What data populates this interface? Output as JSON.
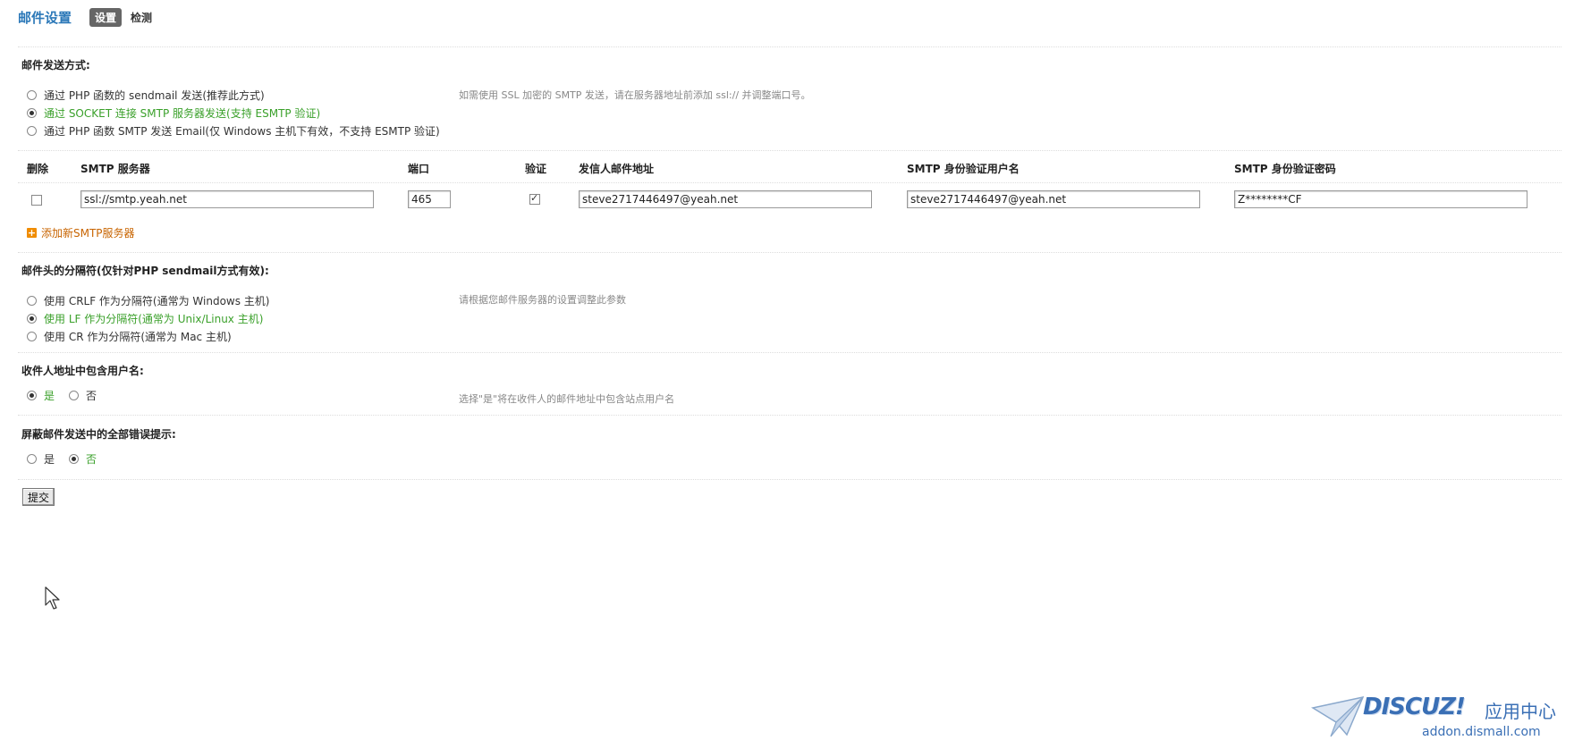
{
  "header": {
    "title": "邮件设置",
    "tabs": [
      {
        "label": "设置",
        "active": true
      },
      {
        "label": "检测",
        "active": false
      }
    ]
  },
  "send_method": {
    "title": "邮件发送方式:",
    "hint": "如需使用 SSL 加密的 SMTP 发送，请在服务器地址前添加 ssl:// 并调整端口号。",
    "options": [
      {
        "label": "通过 PHP 函数的 sendmail 发送(推荐此方式)",
        "checked": false
      },
      {
        "label": "通过 SOCKET 连接 SMTP 服务器发送(支持 ESMTP 验证)",
        "checked": true
      },
      {
        "label": "通过 PHP 函数 SMTP 发送 Email(仅 Windows 主机下有效，不支持 ESMTP 验证)",
        "checked": false
      }
    ]
  },
  "smtp_table": {
    "headers": {
      "delete": "删除",
      "server": "SMTP 服务器",
      "port": "端口",
      "auth": "验证",
      "from": "发信人邮件地址",
      "username": "SMTP 身份验证用户名",
      "password": "SMTP 身份验证密码"
    },
    "rows": [
      {
        "delete": false,
        "server": "ssl://smtp.yeah.net",
        "port": "465",
        "auth": true,
        "from": "steve2717446497@yeah.net",
        "username": "steve2717446497@yeah.net",
        "password": "Z********CF"
      }
    ],
    "add_label": "添加新SMTP服务器"
  },
  "separator": {
    "title": "邮件头的分隔符(仅针对PHP sendmail方式有效):",
    "hint": "请根据您邮件服务器的设置调整此参数",
    "options": [
      {
        "label": "使用 CRLF 作为分隔符(通常为 Windows 主机)",
        "checked": false
      },
      {
        "label": "使用 LF 作为分隔符(通常为 Unix/Linux 主机)",
        "checked": true
      },
      {
        "label": "使用 CR 作为分隔符(通常为 Mac 主机)",
        "checked": false
      }
    ]
  },
  "include_username": {
    "title": "收件人地址中包含用户名:",
    "hint": "选择\"是\"将在收件人的邮件地址中包含站点用户名",
    "yes": "是",
    "no": "否",
    "selected": "yes"
  },
  "silent_errors": {
    "title": "屏蔽邮件发送中的全部错误提示:",
    "yes": "是",
    "no": "否",
    "selected": "no"
  },
  "submit_label": "提交",
  "watermark": {
    "brand": "DISCUZ!",
    "cn": "应用中心",
    "url": "addon.dismall.com"
  },
  "colors": {
    "title": "#2b78b8",
    "selected": "#3aa02a",
    "link": "#c86400",
    "hint": "#888888"
  }
}
